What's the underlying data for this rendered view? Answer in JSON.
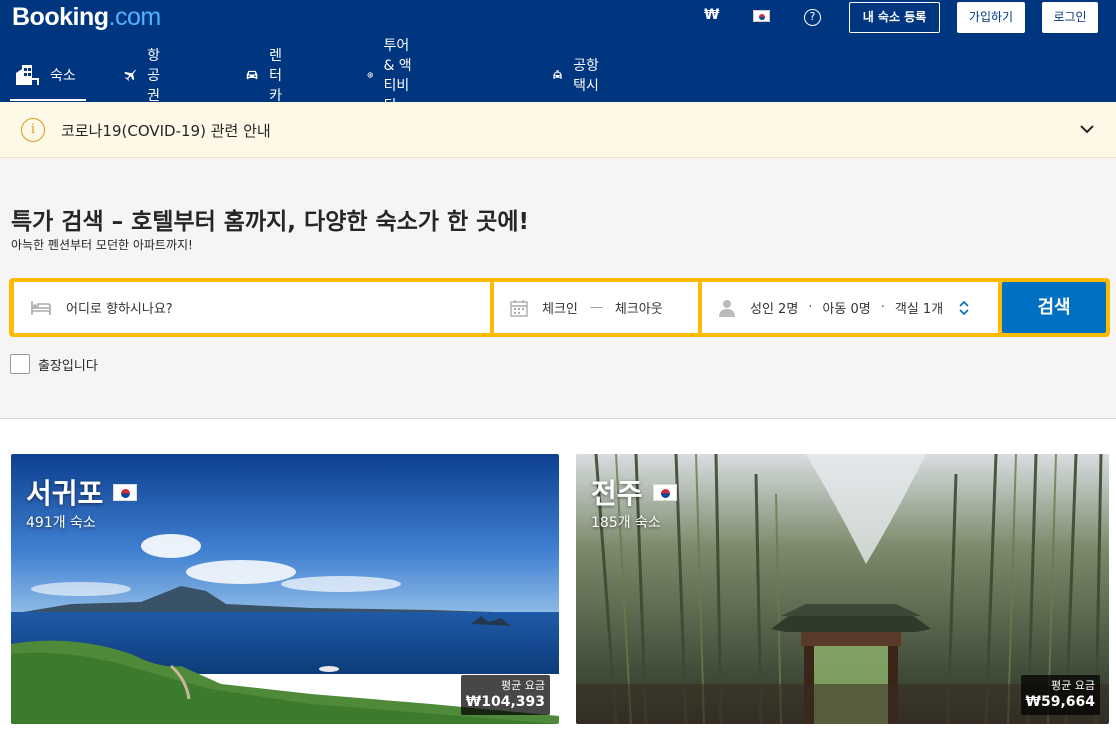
{
  "header": {
    "logo_main": "Booking",
    "logo_dot": ".com",
    "currency": "₩",
    "help": "?",
    "list_property": "내 숙소 등록",
    "signup": "가입하기",
    "login": "로그인"
  },
  "nav": {
    "stays": "숙소",
    "flights": "항공권",
    "cars": "렌터카",
    "tours": "투어 & 액티비티",
    "taxi": "공항 택시"
  },
  "covid": {
    "info": "i",
    "text": "코로나19(COVID-19) 관련 안내"
  },
  "hero": {
    "title": "특가 검색 – 호텔부터 홈까지, 다양한 숙소가 한 곳에!",
    "subtitle": "아늑한 펜션부터 모던한 아파트까지!"
  },
  "search": {
    "destination_placeholder": "어디로 향하시나요?",
    "checkin": "체크인",
    "date_sep": "—",
    "checkout": "체크아웃",
    "adults": "성인 2명",
    "children": "아동 0명",
    "rooms": "객실 1개",
    "sep": "·",
    "button": "검색",
    "business_trip": "출장입니다"
  },
  "cards": [
    {
      "name": "서귀포",
      "count": "491개 숙소",
      "price_label": "평균 요금",
      "price": "₩104,393"
    },
    {
      "name": "전주",
      "count": "185개 숙소",
      "price_label": "평균 요금",
      "price": "₩59,664"
    }
  ],
  "colors": {
    "brand_blue": "#003580",
    "search_yellow": "#febb02",
    "button_blue": "#0071c2"
  }
}
